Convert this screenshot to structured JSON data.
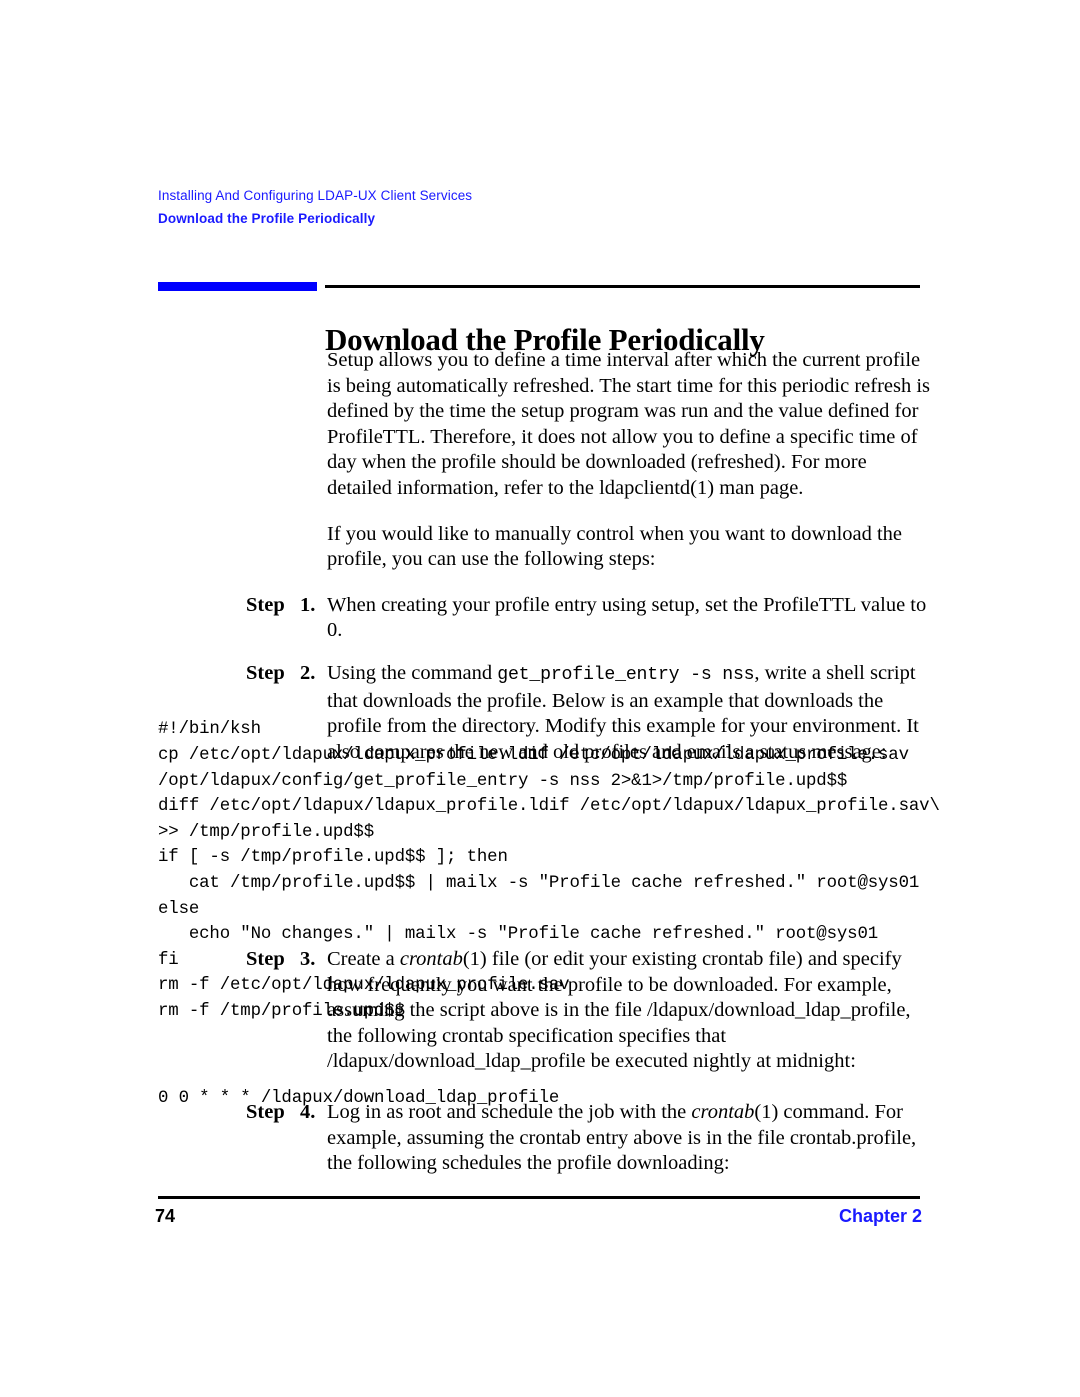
{
  "header": {
    "chapter_title": "Installing And Configuring LDAP-UX Client Services",
    "section_title": "Download the Profile Periodically"
  },
  "heading": "Download the Profile Periodically",
  "colors": {
    "accent_blue": "#0000ff",
    "header_blue": "#1a1aff",
    "rule_black": "#000000",
    "text": "#000000"
  },
  "paragraphs": {
    "intro": "Setup allows you to define a time interval after which the current profile is being automatically refreshed. The start time for this periodic refresh is defined by the time the setup program was run and the value defined for ProfileTTL. Therefore, it does not allow you to define a specific time of day when the profile should be downloaded (refreshed). For more detailed information, refer to the ldapclientd(1) man page.",
    "manual": "If you would like to manually control when you want to download the profile, you can use the following steps:"
  },
  "steps": [
    {
      "word": "Step",
      "number": "1.",
      "text": "When creating your profile entry using setup, set the ProfileTTL value to 0."
    },
    {
      "word": "Step",
      "number": "2.",
      "text_before": "Using the command ",
      "mono": "get_profile_entry -s nss",
      "text_after": ", write a shell script that downloads the profile. Below is an example that downloads the profile from the directory. Modify this example for your environment. It also compares the new and old profiles and emails a status message:"
    },
    {
      "word": "Step",
      "number": "3.",
      "text_before": "Create a ",
      "italic": "crontab",
      "text_after": "(1) file (or edit your existing crontab file) and specify how frequently you want the profile to be downloaded. For example, assuming the script above is in the file /ldapux/download_ldap_profile, the following crontab specification specifies that /ldapux/download_ldap_profile be executed nightly at midnight:"
    },
    {
      "word": "Step",
      "number": "4.",
      "text_before": "Log in as root and schedule the job with the ",
      "italic": "crontab",
      "text_after": "(1) command. For example, assuming the crontab entry above is in the file crontab.profile, the following schedules the profile downloading:"
    }
  ],
  "code_script": "#!/bin/ksh\ncp /etc/opt/ldapux/ldapux_profile.ldif /etc/opt/ldapux/ldapux_profile.sav\n/opt/ldapux/config/get_profile_entry -s nss 2>&1>/tmp/profile.upd$$\ndiff /etc/opt/ldapux/ldapux_profile.ldif /etc/opt/ldapux/ldapux_profile.sav\\\n>> /tmp/profile.upd$$\nif [ -s /tmp/profile.upd$$ ]; then\n   cat /tmp/profile.upd$$ | mailx -s \"Profile cache refreshed.\" root@sys01\nelse\n   echo \"No changes.\" | mailx -s \"Profile cache refreshed.\" root@sys01\nfi\nrm -f /etc/opt/ldapux/ldapux_profile.sav\nrm -f /tmp/profile.upd$$",
  "code_crontab": "0 0 * * * /ldapux/download_ldap_profile",
  "footer": {
    "page_number": "74",
    "chapter_label": "Chapter 2"
  }
}
